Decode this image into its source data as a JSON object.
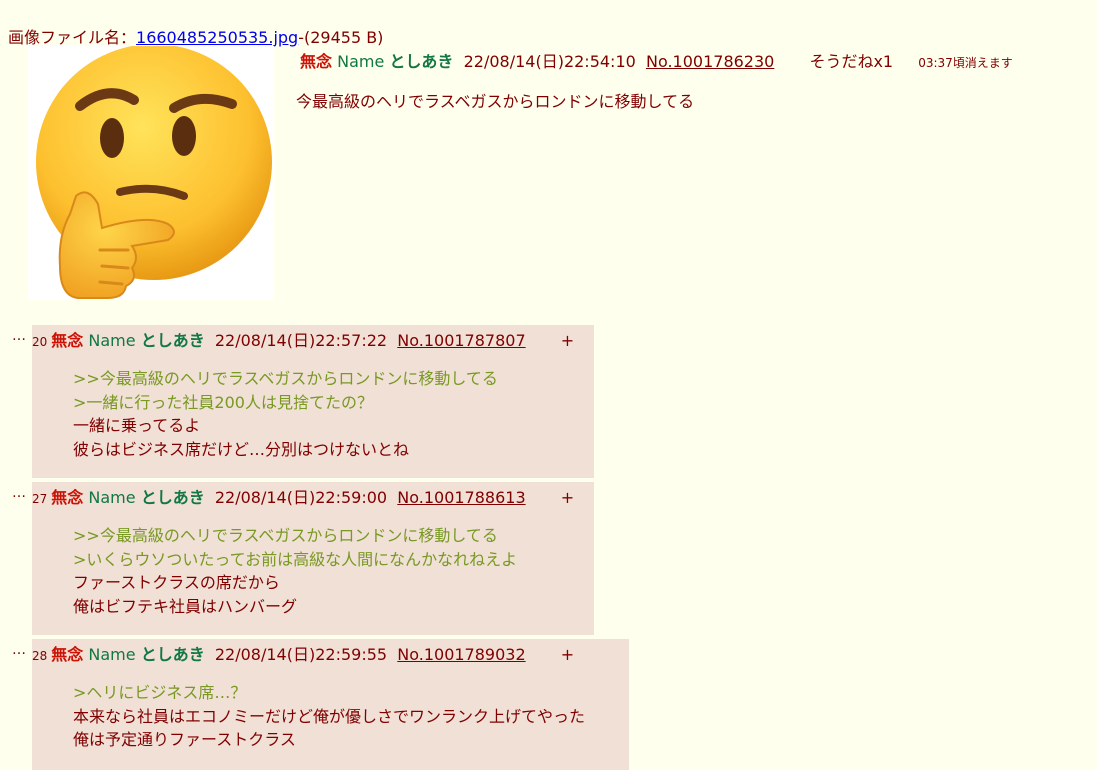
{
  "op": {
    "file_label": "画像ファイル名：",
    "file_name": "1660485250535.jpg",
    "file_size": "-(29455 B)",
    "subject": "無念",
    "name_label": "Name",
    "name": "としあき",
    "datetime": "22/08/14(日)22:54:10",
    "number": "No.1001786230",
    "sodane": "そうだねx1",
    "expire": "03:37頃消えます",
    "body": "今最高級のヘリでラスベガスからロンドンに移動してる"
  },
  "replies": [
    {
      "dots": "…",
      "index": "20",
      "subject": "無念",
      "name_label": "Name",
      "name": "としあき",
      "datetime": "22/08/14(日)22:57:22",
      "number": "No.1001787807",
      "plus": "+",
      "lines": [
        {
          "text": ">>今最高級のヘリでラスベガスからロンドンに移動してる",
          "quote": true
        },
        {
          "text": ">一緒に行った社員200人は見捨てたの？",
          "quote": true
        },
        {
          "text": "一緒に乗ってるよ",
          "quote": false
        },
        {
          "text": "彼らはビジネス席だけど…分別はつけないとね",
          "quote": false
        }
      ]
    },
    {
      "dots": "…",
      "index": "27",
      "subject": "無念",
      "name_label": "Name",
      "name": "としあき",
      "datetime": "22/08/14(日)22:59:00",
      "number": "No.1001788613",
      "plus": "+",
      "lines": [
        {
          "text": ">>今最高級のヘリでラスベガスからロンドンに移動してる",
          "quote": true
        },
        {
          "text": ">いくらウソついたってお前は高級な人間になんかなれねえよ",
          "quote": true
        },
        {
          "text": "ファーストクラスの席だから",
          "quote": false
        },
        {
          "text": "俺はビフテキ社員はハンバーグ",
          "quote": false
        }
      ]
    },
    {
      "dots": "…",
      "index": "28",
      "subject": "無念",
      "name_label": "Name",
      "name": "としあき",
      "datetime": "22/08/14(日)22:59:55",
      "number": "No.1001789032",
      "plus": "+",
      "lines": [
        {
          "text": ">ヘリにビジネス席…？",
          "quote": true
        },
        {
          "text": "本来なら社員はエコノミーだけど俺が優しさでワンランク上げてやった",
          "quote": false
        },
        {
          "text": "俺は予定通りファーストクラス",
          "quote": false
        }
      ]
    }
  ],
  "colors": {
    "background": "#FFFFEE",
    "reply_background": "#F0E0D6",
    "text": "#800000",
    "subject": "#CC1105",
    "name": "#117743",
    "quote": "#789922",
    "link": "#0000EE"
  },
  "thumbnail": {
    "icon": "thinking-face-icon"
  }
}
